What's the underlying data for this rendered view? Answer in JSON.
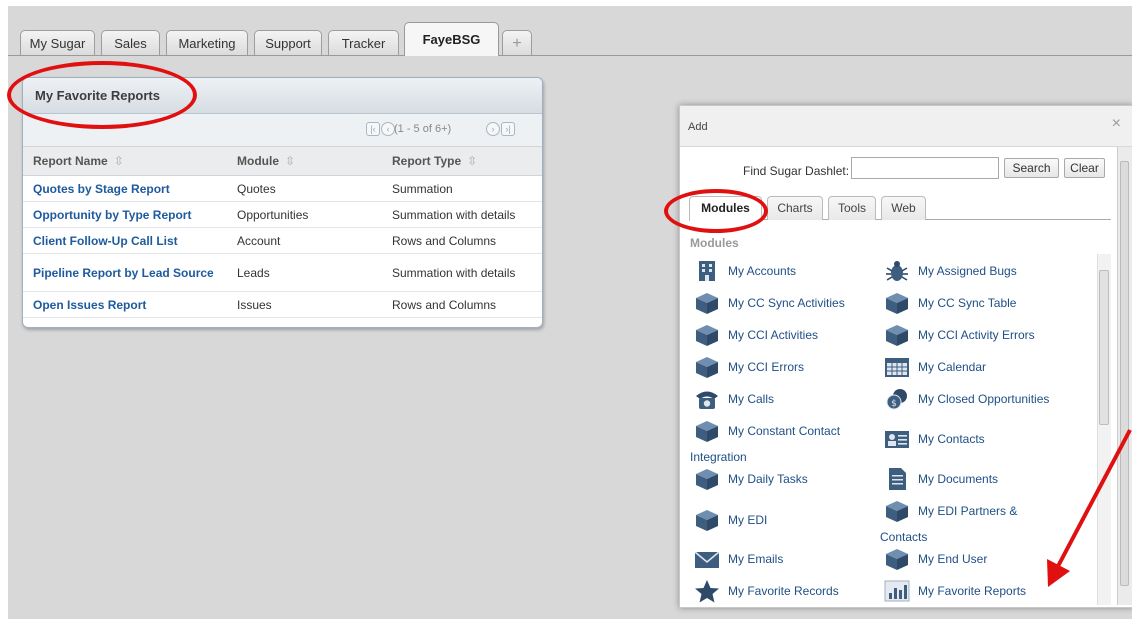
{
  "top_tabs": [
    {
      "label": "My Sugar"
    },
    {
      "label": "Sales"
    },
    {
      "label": "Marketing"
    },
    {
      "label": "Support"
    },
    {
      "label": "Tracker"
    },
    {
      "label": "FayeBSG"
    },
    {
      "label": "+"
    }
  ],
  "dashlet": {
    "title": "My Favorite Reports",
    "pager_text": "(1 - 5 of 6+)",
    "columns": [
      "Report Name",
      "Module",
      "Report Type"
    ],
    "rows": [
      {
        "name": "Quotes by Stage Report",
        "module": "Quotes",
        "type": "Summation"
      },
      {
        "name": "Opportunity by Type Report",
        "module": "Opportunities",
        "type": "Summation with details"
      },
      {
        "name": "Client Follow-Up Call List",
        "module": "Account",
        "type": "Rows and Columns"
      },
      {
        "name": "Pipeline Report by Lead Source",
        "module": "Leads",
        "type": "Summation with details"
      },
      {
        "name": "Open Issues Report",
        "module": "Issues",
        "type": "Rows and Columns"
      }
    ]
  },
  "modal": {
    "title": "Add",
    "close": "×",
    "find_label": "Find Sugar Dashlet:",
    "search_button": "Search",
    "clear_button": "Clear",
    "tabs": [
      "Modules",
      "Charts",
      "Tools",
      "Web"
    ],
    "section_label": "Modules",
    "items": [
      {
        "label": "My Accounts",
        "icon": "building-icon"
      },
      {
        "label": "My Assigned Bugs",
        "icon": "bug-icon"
      },
      {
        "label": "My CC Sync Activities",
        "icon": "cube-icon"
      },
      {
        "label": "My CC Sync Table",
        "icon": "cube-icon"
      },
      {
        "label": "My CCI Activities",
        "icon": "cube-icon"
      },
      {
        "label": "My CCI Activity Errors",
        "icon": "cube-icon"
      },
      {
        "label": "My CCI Errors",
        "icon": "cube-icon"
      },
      {
        "label": "My Calendar",
        "icon": "calendar-icon"
      },
      {
        "label": "My Calls",
        "icon": "phone-icon"
      },
      {
        "label": "My Closed Opportunities",
        "icon": "coins-icon"
      },
      {
        "label": "My Constant Contact",
        "label2": "Integration",
        "icon": "cube-icon"
      },
      {
        "label": "My Contacts",
        "icon": "contact-card-icon"
      },
      {
        "label": "My Daily Tasks",
        "icon": "cube-icon"
      },
      {
        "label": "My Documents",
        "icon": "document-icon"
      },
      {
        "label": "My EDI",
        "icon": "cube-icon"
      },
      {
        "label": "My EDI Partners &",
        "label2": "Contacts",
        "icon": "cube-icon"
      },
      {
        "label": "My Emails",
        "icon": "envelope-icon"
      },
      {
        "label": "My End User",
        "icon": "cube-icon"
      },
      {
        "label": "My Favorite Records",
        "icon": "star-icon"
      },
      {
        "label": "My Favorite Reports",
        "icon": "bar-chart-icon"
      }
    ]
  },
  "colors": {
    "annotation": "#e01010",
    "link": "#1d5a9e"
  }
}
